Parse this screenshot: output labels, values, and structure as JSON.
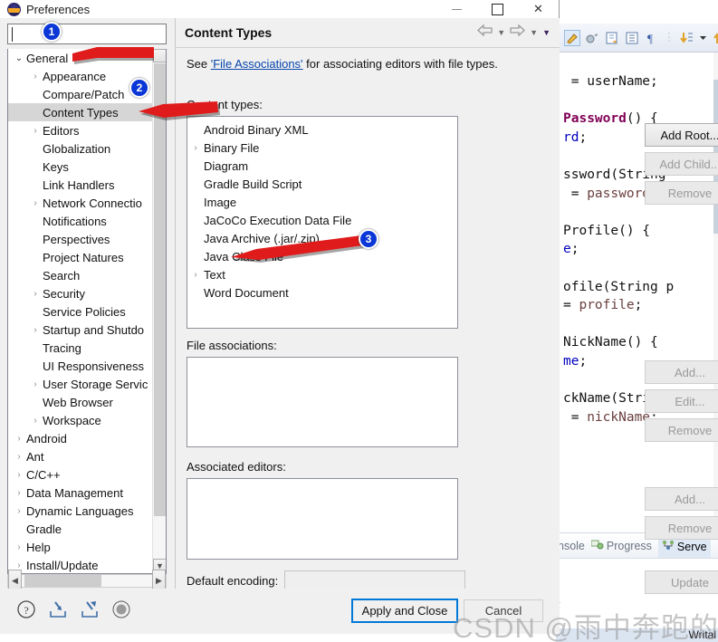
{
  "dialog": {
    "title": "Preferences",
    "icon": "eclipse-globe-icon",
    "window_controls": {
      "minimize": "minimize-icon",
      "maximize": "maximize-icon",
      "close": "✕"
    },
    "filter": {
      "value": "",
      "placeholder": ""
    }
  },
  "sidebar": {
    "items": [
      {
        "label": "General",
        "level": 0,
        "arrow": "open",
        "selected": false
      },
      {
        "label": "Appearance",
        "level": 1,
        "arrow": "closed",
        "selected": false
      },
      {
        "label": "Compare/Patch",
        "level": 1,
        "arrow": "none",
        "selected": false
      },
      {
        "label": "Content Types",
        "level": 1,
        "arrow": "none",
        "selected": true
      },
      {
        "label": "Editors",
        "level": 1,
        "arrow": "closed",
        "selected": false
      },
      {
        "label": "Globalization",
        "level": 1,
        "arrow": "none",
        "selected": false
      },
      {
        "label": "Keys",
        "level": 1,
        "arrow": "none",
        "selected": false
      },
      {
        "label": "Link Handlers",
        "level": 1,
        "arrow": "none",
        "selected": false
      },
      {
        "label": "Network Connectio",
        "level": 1,
        "arrow": "closed",
        "selected": false
      },
      {
        "label": "Notifications",
        "level": 1,
        "arrow": "none",
        "selected": false
      },
      {
        "label": "Perspectives",
        "level": 1,
        "arrow": "none",
        "selected": false
      },
      {
        "label": "Project Natures",
        "level": 1,
        "arrow": "none",
        "selected": false
      },
      {
        "label": "Search",
        "level": 1,
        "arrow": "none",
        "selected": false
      },
      {
        "label": "Security",
        "level": 1,
        "arrow": "closed",
        "selected": false
      },
      {
        "label": "Service Policies",
        "level": 1,
        "arrow": "none",
        "selected": false
      },
      {
        "label": "Startup and Shutdo",
        "level": 1,
        "arrow": "closed",
        "selected": false
      },
      {
        "label": "Tracing",
        "level": 1,
        "arrow": "none",
        "selected": false
      },
      {
        "label": "UI Responsiveness",
        "level": 1,
        "arrow": "none",
        "selected": false
      },
      {
        "label": "User Storage Servic",
        "level": 1,
        "arrow": "closed",
        "selected": false
      },
      {
        "label": "Web Browser",
        "level": 1,
        "arrow": "none",
        "selected": false
      },
      {
        "label": "Workspace",
        "level": 1,
        "arrow": "closed",
        "selected": false
      },
      {
        "label": "Android",
        "level": 0,
        "arrow": "closed",
        "selected": false
      },
      {
        "label": "Ant",
        "level": 0,
        "arrow": "closed",
        "selected": false
      },
      {
        "label": "C/C++",
        "level": 0,
        "arrow": "closed",
        "selected": false
      },
      {
        "label": "Data Management",
        "level": 0,
        "arrow": "closed",
        "selected": false
      },
      {
        "label": "Dynamic Languages",
        "level": 0,
        "arrow": "closed",
        "selected": false
      },
      {
        "label": "Gradle",
        "level": 0,
        "arrow": "none",
        "selected": false
      },
      {
        "label": "Help",
        "level": 0,
        "arrow": "closed",
        "selected": false
      },
      {
        "label": "Install/Update",
        "level": 0,
        "arrow": "closed",
        "selected": false
      }
    ]
  },
  "page": {
    "title": "Content Types",
    "nav": {
      "back": "back-arrow-icon",
      "forward": "forward-arrow-icon",
      "menu": "dropdown-arrow-icon"
    },
    "description_prefix": "See ",
    "description_link": "'File Associations'",
    "description_suffix": " for associating editors with file types.",
    "content_types_label": "Content types:",
    "content_types": [
      {
        "label": "Android Binary XML",
        "arrow": "none"
      },
      {
        "label": "Binary File",
        "arrow": "closed"
      },
      {
        "label": "Diagram",
        "arrow": "none"
      },
      {
        "label": "Gradle Build Script",
        "arrow": "none"
      },
      {
        "label": "Image",
        "arrow": "none"
      },
      {
        "label": "JaCoCo Execution Data File",
        "arrow": "none"
      },
      {
        "label": "Java Archive (.jar/.zip)",
        "arrow": "none"
      },
      {
        "label": "Java Class File",
        "arrow": "none"
      },
      {
        "label": "Text",
        "arrow": "closed"
      },
      {
        "label": "Word Document",
        "arrow": "none"
      }
    ],
    "content_buttons": [
      {
        "label": "Add Root...",
        "enabled": true
      },
      {
        "label": "Add Child...",
        "enabled": false
      },
      {
        "label": "Remove",
        "enabled": false
      }
    ],
    "file_associations_label": "File associations:",
    "file_associations": [],
    "file_assoc_buttons": [
      {
        "label": "Add...",
        "enabled": false
      },
      {
        "label": "Edit...",
        "enabled": false
      },
      {
        "label": "Remove",
        "enabled": false
      }
    ],
    "associated_editors_label": "Associated editors:",
    "associated_editors": [],
    "assoc_editor_buttons": [
      {
        "label": "Add...",
        "enabled": false
      },
      {
        "label": "Remove",
        "enabled": false
      }
    ],
    "default_encoding_label": "Default encoding:",
    "default_encoding_value": "",
    "update_button": {
      "label": "Update",
      "enabled": false
    }
  },
  "footer": {
    "icons": [
      "help-icon",
      "import-icon",
      "export-icon",
      "record-icon"
    ],
    "apply_and_close": "Apply and Close",
    "cancel": "Cancel"
  },
  "annotations": [
    {
      "number": "1"
    },
    {
      "number": "2"
    },
    {
      "number": "3"
    }
  ],
  "background_ide": {
    "code_lines": [
      " = userName;",
      "",
      "Password() {",
      "rd;",
      "",
      "ssword(String",
      " = password;",
      "",
      "Profile() {",
      "e;",
      "",
      "ofile(String p",
      "= profile;",
      "",
      "NickName() {",
      "me;",
      "",
      "ckName(String",
      " = nickName;"
    ],
    "tabs": [
      {
        "label": "nsole",
        "icon": "console-icon",
        "active": false
      },
      {
        "label": "Progress",
        "icon": "progress-icon",
        "active": false
      },
      {
        "label": "Serve",
        "icon": "servers-icon",
        "active": true
      }
    ],
    "status_text": "Writal"
  },
  "watermark": "CSDN @雨中奔跑的小孩"
}
